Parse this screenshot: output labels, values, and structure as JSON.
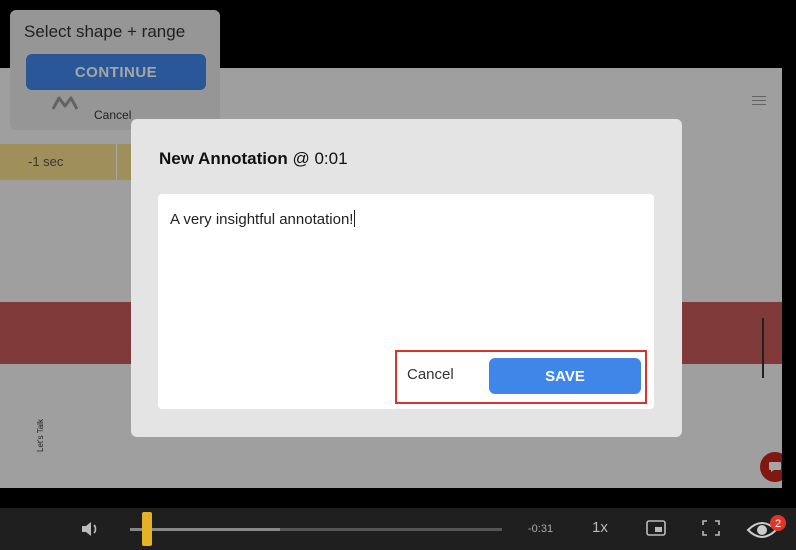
{
  "shape_panel": {
    "title": "Select shape + range",
    "continue_label": "CONTINUE",
    "cancel_label": "Cancel"
  },
  "video": {
    "marker_label": "-1 sec",
    "side_text": "Let's Talk"
  },
  "modal": {
    "title_bold": "New Annotation",
    "title_rest": "@ 0:01",
    "annotation_text": "A very insightful annotation!",
    "cancel_label": "Cancel",
    "save_label": "SAVE"
  },
  "controls": {
    "time_remaining": "-0:31",
    "speed": "1x",
    "badge_count": "2"
  },
  "colors": {
    "accent": "#3f86e8",
    "highlight_border": "#d9342b",
    "scrub_thumb": "#e4b227",
    "badge": "#e0352b"
  },
  "icons": [
    "volume-icon",
    "pip-icon",
    "fullscreen-icon",
    "eye-icon",
    "chat-icon",
    "menu-icon",
    "logo-icon"
  ]
}
